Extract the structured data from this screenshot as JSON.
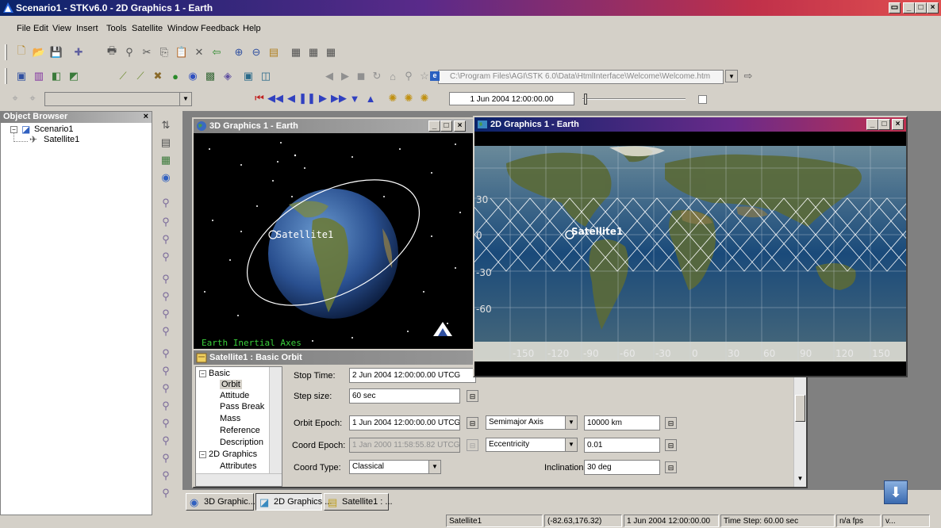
{
  "app": {
    "title": "Scenario1 - STKv6.0 - 2D Graphics 1 - Earth"
  },
  "menu": [
    "File",
    "Edit",
    "View",
    "Insert",
    "Tools",
    "Satellite",
    "Window",
    "Feedback",
    "Help"
  ],
  "address_bar": {
    "value": "C:\\Program Files\\AGI\\STK 6.0\\Data\\HtmlInterface\\Welcome\\Welcome.htm"
  },
  "animation": {
    "current_time": "1 Jun 2004 12:00:00.00"
  },
  "object_browser": {
    "title": "Object Browser",
    "items": [
      {
        "label": "Scenario1"
      },
      {
        "label": "Satellite1"
      }
    ]
  },
  "win3d": {
    "title": "3D Graphics 1 - Earth",
    "satellite_label": "Satellite1",
    "axes_label": "Earth Inertial Axes"
  },
  "win2d": {
    "title": "2D Graphics 1 - Earth",
    "satellite_label": "Satellite1",
    "lat_labels": [
      "30",
      "0",
      "-30",
      "-60"
    ],
    "lon_labels": [
      "-150",
      "-120",
      "-90",
      "-60",
      "-30",
      "0",
      "30",
      "60",
      "90",
      "120",
      "150"
    ]
  },
  "orbit": {
    "title": "Satellite1 : Basic Orbit",
    "tree": [
      {
        "label": "Basic"
      },
      {
        "label": "Orbit"
      },
      {
        "label": "Attitude"
      },
      {
        "label": "Pass Break"
      },
      {
        "label": "Mass"
      },
      {
        "label": "Reference"
      },
      {
        "label": "Description"
      },
      {
        "label": "2D Graphics"
      },
      {
        "label": "Attributes"
      }
    ],
    "stop_time_label": "Stop Time:",
    "stop_time": "2 Jun 2004 12:00:00.00 UTCG",
    "step_label": "Step size:",
    "step": "60 sec",
    "epoch_label": "Orbit Epoch:",
    "epoch": "1 Jun 2004 12:00:00.00 UTCG",
    "coord_epoch_label": "Coord Epoch:",
    "coord_epoch": "1 Jan 2000 11:58:55.82 UTCG",
    "coord_type_label": "Coord Type:",
    "coord_type": "Classical",
    "sma_select": "Semimajor Axis",
    "sma": "10000 km",
    "ecc_select": "Eccentricity",
    "ecc": "0.01",
    "inc_label": "Inclination",
    "inc": "30 deg"
  },
  "taskbar": [
    {
      "label": "3D Graphic..."
    },
    {
      "label": "2D Graphics ..."
    },
    {
      "label": "Satellite1 : ..."
    }
  ],
  "status": {
    "object": "Satellite1",
    "coords": "(-82.63,176.32)",
    "time": "1 Jun 2004 12:00:00.00",
    "step": "Time Step: 60.00 sec",
    "fps": "n/a fps",
    "extra": "v..."
  }
}
